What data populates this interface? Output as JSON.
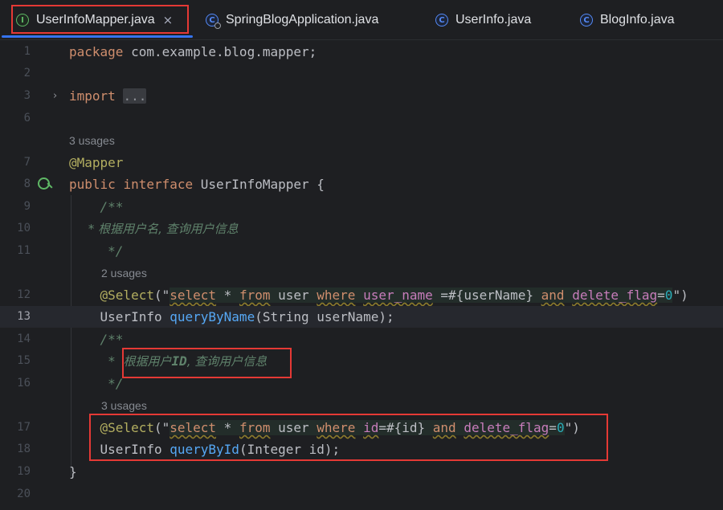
{
  "tabs": [
    {
      "label": "UserInfoMapper.java",
      "icon": "interface-icon",
      "icon_char": "I",
      "active": true,
      "closable": true
    },
    {
      "label": "SpringBlogApplication.java",
      "icon": "spring-boot-class-icon",
      "icon_char": "C"
    },
    {
      "label": "UserInfo.java",
      "icon": "class-icon",
      "icon_char": "C"
    },
    {
      "label": "BlogInfo.java",
      "icon": "class-icon",
      "icon_char": "C"
    }
  ],
  "tab_close_glyph": "×",
  "fold_glyph": "›",
  "colors": {
    "keyword": "#cf8e6d",
    "annotation": "#b3ae60",
    "comment": "#7a7e85",
    "doc": "#5f826b",
    "string": "#6aab73",
    "method": "#56a8f5",
    "sql_column": "#c77dbb",
    "number": "#2aacb8",
    "highlight_red": "#e53935",
    "accent_blue": "#3574f0"
  },
  "editor": {
    "lines": [
      {
        "n": "1",
        "segs": [
          [
            "package",
            "kw"
          ],
          [
            " com.example.blog.mapper;",
            "pl"
          ]
        ]
      },
      {
        "n": "2",
        "segs": []
      },
      {
        "n": "3",
        "fold": true,
        "segs": [
          [
            "import",
            "kw"
          ],
          [
            " ",
            "pl"
          ],
          [
            "...",
            "fold"
          ]
        ]
      },
      {
        "n": "6",
        "segs": []
      },
      {
        "usage": "3 usages"
      },
      {
        "n": "7",
        "segs": [
          [
            "@Mapper",
            "an"
          ]
        ]
      },
      {
        "n": "8",
        "gutter_icon": "implemented-icon",
        "segs": [
          [
            "public",
            "kw"
          ],
          [
            " ",
            "pl"
          ],
          [
            "interface",
            "kw"
          ],
          [
            " UserInfoMapper {",
            "pl"
          ]
        ]
      },
      {
        "n": "9",
        "segs": [
          [
            "    /**",
            "doc"
          ]
        ]
      },
      {
        "n": "10",
        "segs": [
          [
            "     * 根据用户名, 查询用户信息",
            "doci"
          ]
        ]
      },
      {
        "n": "11",
        "segs": [
          [
            "     */",
            "doc"
          ]
        ]
      },
      {
        "usage": "2 usages",
        "indent": true
      },
      {
        "n": "12",
        "segs": [
          [
            "    @Select",
            "an"
          ],
          [
            "(\"",
            "pl"
          ],
          [
            "select",
            "sqlkw"
          ],
          [
            " * ",
            "sqlpl"
          ],
          [
            "from",
            "sqlkw"
          ],
          [
            " user ",
            "sqlpl"
          ],
          [
            "where",
            "sqlkw"
          ],
          [
            " ",
            "sqlpl"
          ],
          [
            "user_name",
            "sqlcol"
          ],
          [
            " =#{userName} ",
            "sqlpl"
          ],
          [
            "and",
            "sqlkw"
          ],
          [
            " ",
            "sqlpl"
          ],
          [
            "delete_flag",
            "sqlcol"
          ],
          [
            "=",
            "sqlpl"
          ],
          [
            "0",
            "num"
          ],
          [
            "\")",
            "pl"
          ]
        ]
      },
      {
        "n": "13",
        "current": true,
        "segs": [
          [
            "    UserInfo ",
            "pl"
          ],
          [
            "queryByName",
            "mt"
          ],
          [
            "(String userName);",
            "pl"
          ]
        ]
      },
      {
        "n": "14",
        "segs": [
          [
            "    /**",
            "doc"
          ]
        ]
      },
      {
        "n": "15",
        "segs": [
          [
            "     * ",
            "doc"
          ],
          [
            "根据用户",
            "doci"
          ],
          [
            "ID",
            "docb"
          ],
          [
            ", 查询用户信息",
            "doci"
          ]
        ]
      },
      {
        "n": "16",
        "segs": [
          [
            "     */",
            "doc"
          ]
        ]
      },
      {
        "usage": "3 usages",
        "indent": true
      },
      {
        "n": "17",
        "segs": [
          [
            "    @Select",
            "an"
          ],
          [
            "(\"",
            "pl"
          ],
          [
            "select",
            "sqlkw"
          ],
          [
            " * ",
            "sqlpl"
          ],
          [
            "from",
            "sqlkw"
          ],
          [
            " user ",
            "sqlpl"
          ],
          [
            "where",
            "sqlkw"
          ],
          [
            " ",
            "sqlpl"
          ],
          [
            "id",
            "sqlcol"
          ],
          [
            "=#{id} ",
            "sqlpl"
          ],
          [
            "and",
            "sqlkw"
          ],
          [
            " ",
            "sqlpl"
          ],
          [
            "delete_flag",
            "sqlcol"
          ],
          [
            "=",
            "sqlpl"
          ],
          [
            "0",
            "num"
          ],
          [
            "\")",
            "pl"
          ]
        ]
      },
      {
        "n": "18",
        "segs": [
          [
            "    UserInfo ",
            "pl"
          ],
          [
            "queryById",
            "mt"
          ],
          [
            "(Integer id);",
            "pl"
          ]
        ]
      },
      {
        "n": "19",
        "segs": [
          [
            "}",
            "pl"
          ]
        ]
      },
      {
        "n": "20",
        "segs": []
      }
    ]
  }
}
